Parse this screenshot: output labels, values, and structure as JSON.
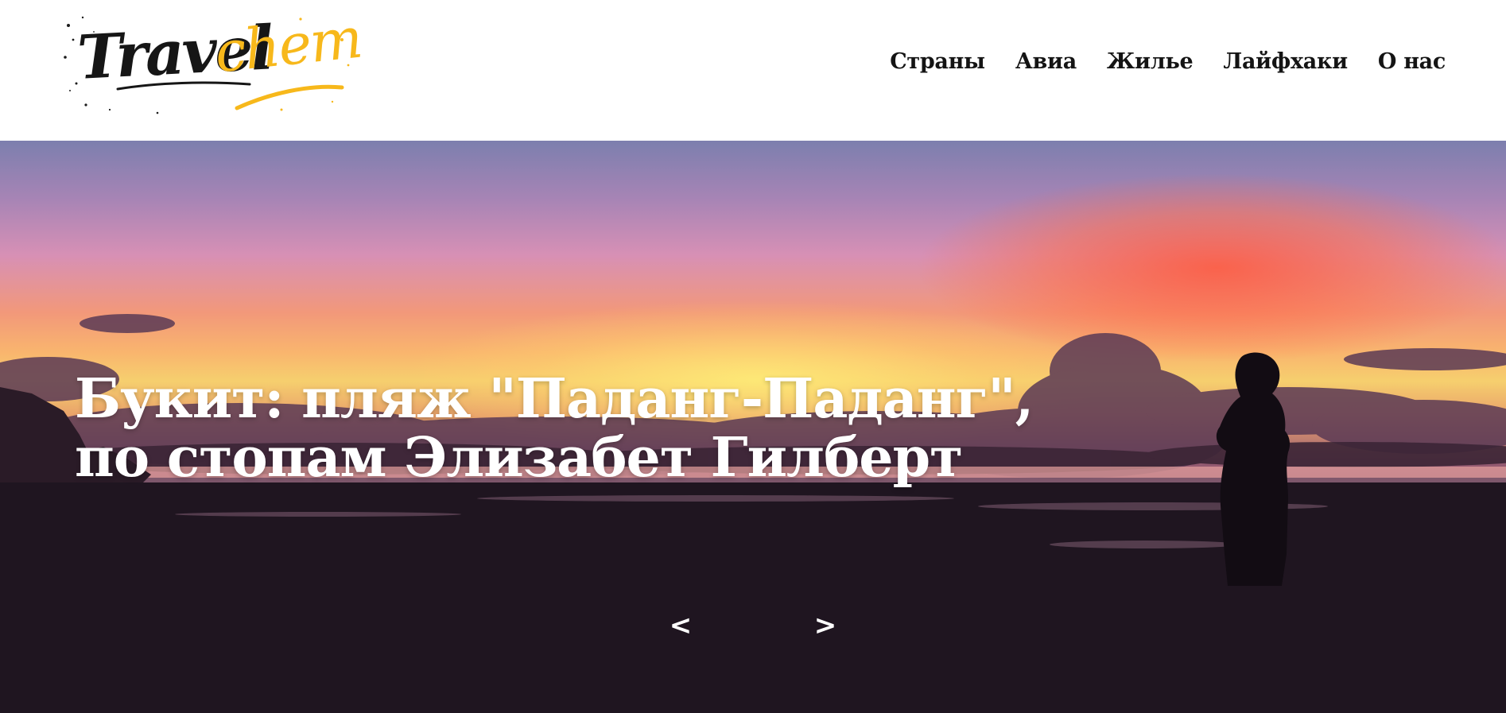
{
  "header": {
    "logo": {
      "part1": "Travel",
      "part2": "chem"
    },
    "nav": [
      "Страны",
      "Авиа",
      "Жилье",
      "Лайфхаки",
      "О нас"
    ]
  },
  "hero": {
    "title_line1": "Букит: пляж \"Паданг-Паданг\",",
    "title_line2": "по стопам Элизабет Гилберт",
    "prev_label": "<",
    "next_label": ">"
  },
  "colors": {
    "logo_accent": "#f7b81b",
    "text_dark": "#141414",
    "hero_text": "#ffffff"
  }
}
